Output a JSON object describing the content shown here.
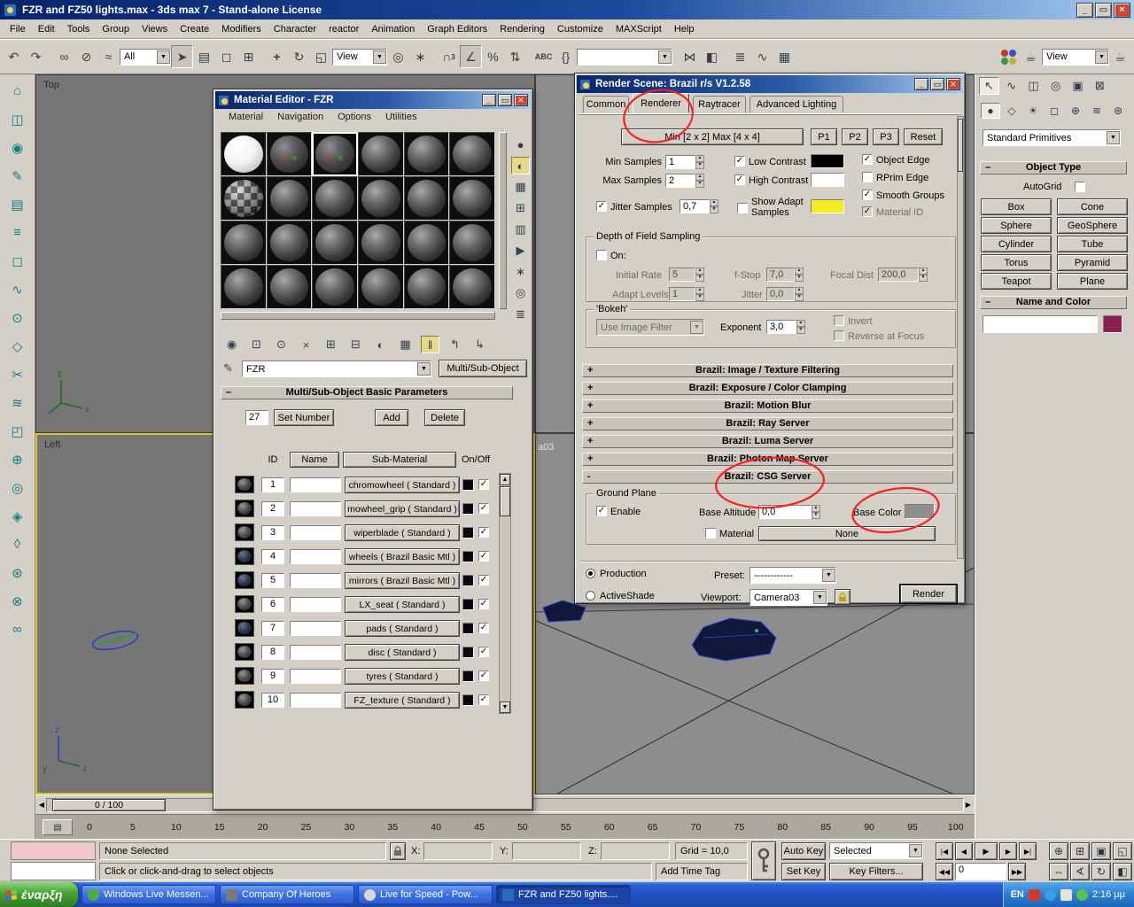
{
  "window": {
    "title": "FZR and FZ50 lights.max - 3ds max 7  - Stand-alone License"
  },
  "menubar": [
    "File",
    "Edit",
    "Tools",
    "Group",
    "Views",
    "Create",
    "Modifiers",
    "Character",
    "reactor",
    "Animation",
    "Graph Editors",
    "Rendering",
    "Customize",
    "MAXScript",
    "Help"
  ],
  "toolbar": {
    "selection_filter": "All",
    "coord_system": "View",
    "snap_count": "3",
    "abc_label": "ABC",
    "render_type": "View"
  },
  "viewports": {
    "top": "Top",
    "left": "Left",
    "camera_fragment": "a03",
    "time_slider": "0 / 100"
  },
  "material_editor": {
    "title": "Material Editor - FZR",
    "menu": [
      "Material",
      "Navigation",
      "Options",
      "Utilities"
    ],
    "name_value": "FZR",
    "type_button": "Multi/Sub-Object",
    "rollout": "Multi/Sub-Object Basic Parameters",
    "count_value": "27",
    "set_number": "Set Number",
    "add": "Add",
    "delete": "Delete",
    "col_id": "ID",
    "col_name": "Name",
    "col_sub": "Sub-Material",
    "col_onoff": "On/Off",
    "rows": [
      {
        "id": "1",
        "sub": "chromowheel ( Standard )"
      },
      {
        "id": "2",
        "sub": "mowheel_grip ( Standard )"
      },
      {
        "id": "3",
        "sub": "wiperblade ( Standard )"
      },
      {
        "id": "4",
        "sub": "wheels ( Brazil Basic Mtl )"
      },
      {
        "id": "5",
        "sub": "mirrors ( Brazil Basic Mtl )"
      },
      {
        "id": "6",
        "sub": "LX_seat ( Standard )"
      },
      {
        "id": "7",
        "sub": "pads ( Standard )"
      },
      {
        "id": "8",
        "sub": "disc ( Standard )"
      },
      {
        "id": "9",
        "sub": "tyres ( Standard )"
      },
      {
        "id": "10",
        "sub": "FZ_texture ( Standard )"
      }
    ]
  },
  "render_scene": {
    "title": "Render Scene: Brazil r/s V1.2.58",
    "tabs": [
      "Common",
      "Renderer",
      "Raytracer",
      "Advanced Lighting"
    ],
    "sampling": {
      "minmax": "Min [2 x 2] Max [4 x 4]",
      "p1": "P1",
      "p2": "P2",
      "p3": "P3",
      "reset": "Reset",
      "min_samples_label": "Min Samples",
      "min_samples_value": "1",
      "max_samples_label": "Max Samples",
      "max_samples_value": "2",
      "low_contrast": "Low Contrast",
      "high_contrast": "High Contrast",
      "jitter_label": "Jitter Samples",
      "jitter_value": "0,7",
      "show_adapt_line1": "Show Adapt",
      "show_adapt_line2": "Samples",
      "object_edge": "Object Edge",
      "rprim_edge": "RPrim Edge",
      "smooth_groups": "Smooth Groups",
      "material_id": "Material ID"
    },
    "dof": {
      "title": "Depth of Field Sampling",
      "on_label": "On:",
      "initial_rate": "Initial Rate",
      "initial_rate_value": "5",
      "fstop": "f-Stop",
      "fstop_value": "7,0",
      "focal_dist": "Focal Dist",
      "focal_dist_value": "200,0",
      "adapt_levels": "Adapt Levels",
      "adapt_levels_value": "1",
      "jitter": "Jitter",
      "jitter_value": "0,0"
    },
    "bokeh": {
      "title": "'Bokeh'",
      "filter_value": "Use Image Filter",
      "exponent": "Exponent",
      "exponent_value": "3,0",
      "invert": "Invert",
      "reverse": "Reverse at Focus"
    },
    "rollouts": [
      {
        "state": "+",
        "label": "Brazil: Image / Texture Filtering"
      },
      {
        "state": "+",
        "label": "Brazil: Exposure / Color Clamping"
      },
      {
        "state": "+",
        "label": "Brazil: Motion Blur"
      },
      {
        "state": "+",
        "label": "Brazil: Ray Server"
      },
      {
        "state": "+",
        "label": "Brazil: Luma Server"
      },
      {
        "state": "+",
        "label": "Brazil: Photon Map Server"
      },
      {
        "state": "-",
        "label": "Brazil: CSG Server"
      }
    ],
    "ground_plane": {
      "title": "Ground Plane",
      "enable": "Enable",
      "base_altitude": "Base Altitude",
      "base_altitude_value": "0,0",
      "base_color": "Base Color",
      "material": "Material",
      "none": "None"
    },
    "footer": {
      "production": "Production",
      "activeshade": "ActiveShade",
      "preset": "Preset:",
      "preset_value": "------------",
      "viewport": "Viewport:",
      "viewport_value": "Camera03",
      "render": "Render"
    }
  },
  "command_panel": {
    "category": "Standard Primitives",
    "object_type": "Object Type",
    "autogrid": "AutoGrid",
    "primitives": [
      "Box",
      "Cone",
      "Sphere",
      "GeoSphere",
      "Cylinder",
      "Tube",
      "Torus",
      "Pyramid",
      "Teapot",
      "Plane"
    ],
    "name_and_color": "Name and Color"
  },
  "timeline": {
    "ticks": [
      "0",
      "5",
      "10",
      "15",
      "20",
      "25",
      "30",
      "35",
      "40",
      "45",
      "50",
      "55",
      "60",
      "65",
      "70",
      "75",
      "80",
      "85",
      "90",
      "95",
      "100"
    ]
  },
  "statusbar": {
    "selection_status": "None Selected",
    "x": "X:",
    "y": "Y:",
    "z": "Z:",
    "grid": "Grid = 10,0",
    "auto_key": "Auto Key",
    "set_key": "Set Key",
    "key_mode": "Selected",
    "key_filters": "Key Filters...",
    "frame": "0",
    "prompt": "Click or click-and-drag to select objects",
    "add_time_tag": "Add Time Tag"
  },
  "taskbar": {
    "start": "έναρξη",
    "tasks": [
      "Windows Live Messen...",
      "Company Of Heroes",
      "Live for Speed - Pow...",
      "FZR and FZ50 lights...."
    ],
    "language": "EN",
    "clock": "2:16 μμ"
  }
}
